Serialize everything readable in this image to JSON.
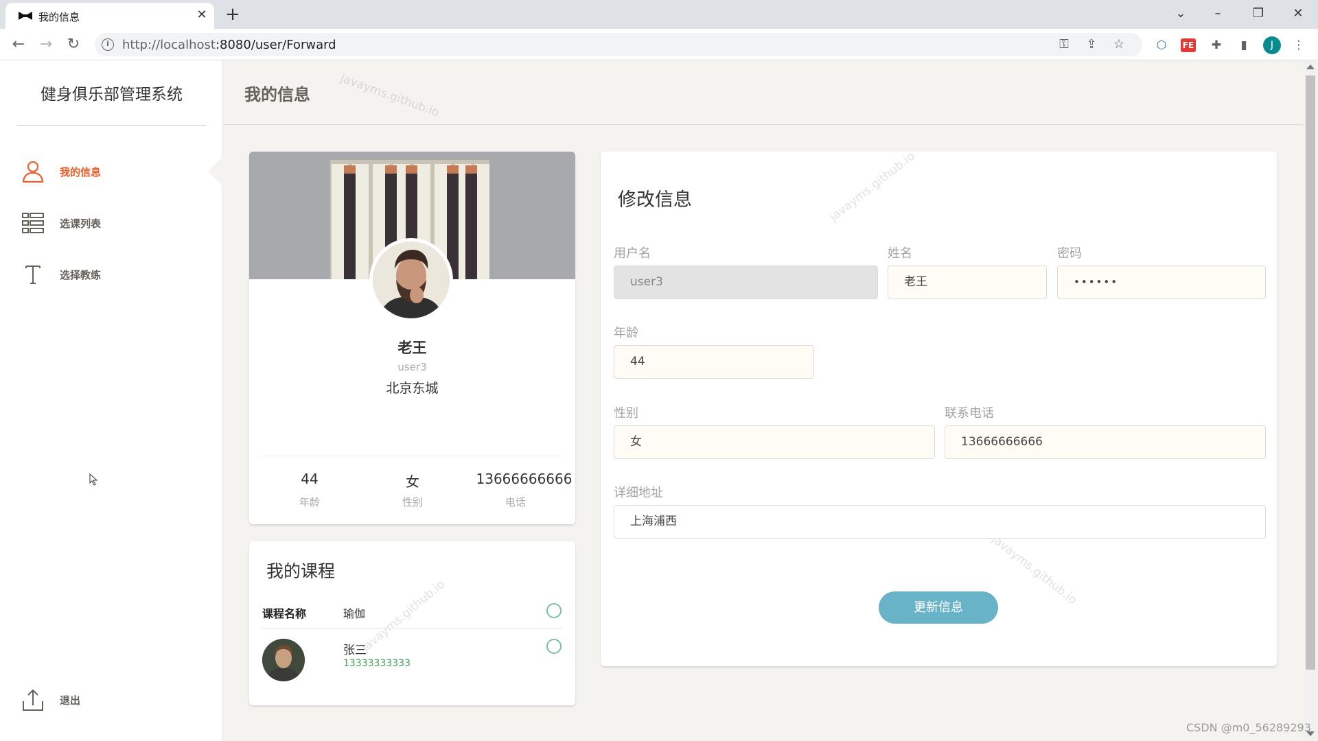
{
  "browser": {
    "tab_title": "我的信息",
    "url_host": "http://localhost",
    "url_rest": ":8080/user/Forward",
    "profile_initial": "J"
  },
  "sidebar": {
    "brand": "健身俱乐部管理系统",
    "items": [
      {
        "label": "我的信息",
        "icon": "user-icon",
        "active": true
      },
      {
        "label": "选课列表",
        "icon": "list-icon",
        "active": false
      },
      {
        "label": "选择教练",
        "icon": "text-icon",
        "active": false
      }
    ],
    "signout": "退出"
  },
  "header": {
    "title": "我的信息"
  },
  "watermark_text": "javayms.github.io",
  "profile": {
    "name": "老王",
    "username": "user3",
    "address": "北京东城",
    "stats": [
      {
        "value": "44",
        "label": "年龄"
      },
      {
        "value": "女",
        "label": "性别"
      },
      {
        "value": "13666666666",
        "label": "电话"
      }
    ]
  },
  "courses": {
    "title": "我的课程",
    "header_label": "课程名称",
    "course_name": "瑜伽",
    "coach_name": "张三",
    "coach_phone": "13333333333"
  },
  "form": {
    "title": "修改信息",
    "username_label": "用户名",
    "username_value": "user3",
    "name_label": "姓名",
    "name_value": "老王",
    "password_label": "密码",
    "password_value": "••••••",
    "age_label": "年龄",
    "age_value": "44",
    "gender_label": "性别",
    "gender_value": "女",
    "phone_label": "联系电话",
    "phone_value": "13666666666",
    "address_label": "详细地址",
    "address_value": "上海浦西",
    "submit_label": "更新信息"
  },
  "colors": {
    "accent": "#eb5e28",
    "button": "#68b3c8",
    "ring": "#7ac29a",
    "phone": "#41a05a"
  },
  "footer_watermark": "CSDN @m0_56289293"
}
